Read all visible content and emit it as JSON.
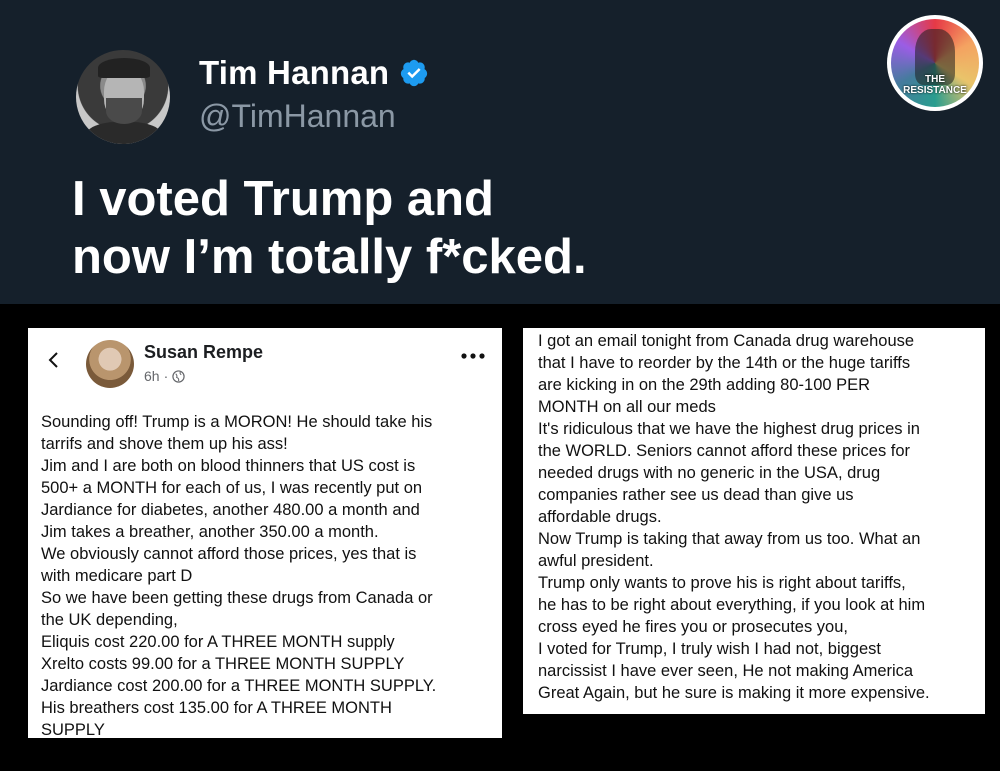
{
  "tweet": {
    "display_name": "Tim Hannan",
    "handle": "@TimHannan",
    "headline_lines": [
      "I voted Trump and",
      "now I’m totally f*cked."
    ],
    "verified_icon": "verified-badge-icon",
    "verified_color": "#1d9bf0"
  },
  "badge": {
    "line1": "THE",
    "line2": "RESISTANCE"
  },
  "facebook_post": {
    "author": "Susan Rempe",
    "time": "6h",
    "separator": "·",
    "icons": [
      "back-arrow-icon",
      "globe-icon",
      "more-options-icon"
    ],
    "lines": [
      "Sounding off! Trump is a MORON! He should take his",
      "tarrifs and shove them up his ass!",
      "Jim and I are both on blood thinners that US cost is",
      "500+ a MONTH for each of us, I was recently put on",
      "Jardiance for diabetes, another 480.00 a month and",
      "Jim takes a breather, another 350.00 a month.",
      "We obviously cannot afford those prices, yes that is",
      "with medicare part D",
      "So we have been getting these drugs from Canada or",
      "the UK depending,",
      "Eliquis cost 220.00 for A THREE MONTH supply",
      "Xrelto costs 99.00 for a THREE MONTH SUPPLY",
      "Jardiance cost 200.00 for a THREE MONTH SUPPLY.",
      "His breathers cost 135.00 for A THREE MONTH",
      "SUPPLY"
    ]
  },
  "continuation_post": {
    "lines": [
      "I got an email tonight from Canada drug warehouse",
      "that I have to reorder by the 14th or the huge tariffs",
      "are kicking in on the 29th adding 80-100 PER",
      "MONTH on all our meds",
      "It's ridiculous that we have the highest drug prices in",
      "the WORLD. Seniors cannot afford these prices for",
      "needed drugs with no generic in the USA, drug",
      "companies rather see us dead than give us",
      "affordable drugs.",
      "Now Trump is taking that away from us too. What an",
      "awful president.",
      "Trump only wants to prove his is right about tariffs,",
      "he has to be right about everything, if you look at him",
      "cross eyed he fires you or prosecutes you,",
      "I voted for Trump, I truly wish I had not, biggest",
      "narcissist I have ever seen, He not making America",
      "Great Again, but he sure is making it more expensive."
    ]
  }
}
